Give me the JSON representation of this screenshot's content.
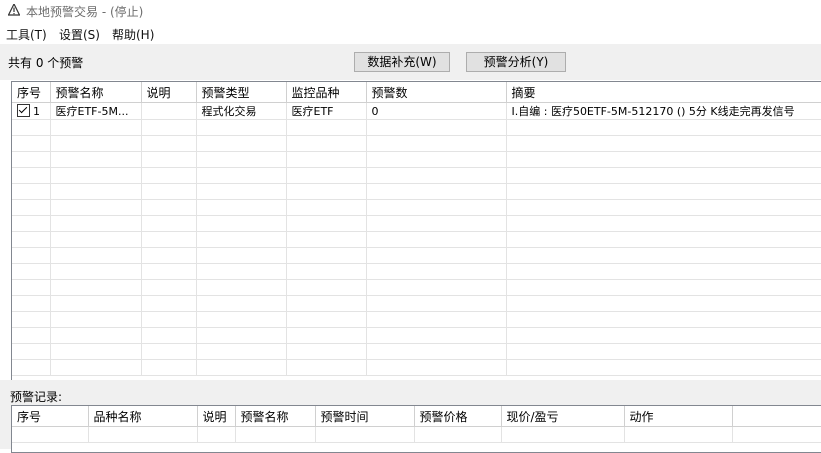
{
  "window": {
    "title": "本地预警交易  - (停止)"
  },
  "menu": {
    "tools": "工具(T)",
    "settings": "设置(S)",
    "help": "帮助(H)"
  },
  "toolbar": {
    "alert_count": "共有 0 个预警",
    "supplement_button": "数据补充(W)",
    "analysis_button": "预警分析(Y)"
  },
  "alerts_table": {
    "headers": [
      "序号",
      "预警名称",
      "说明",
      "预警类型",
      "监控品种",
      "预警数",
      "摘要"
    ],
    "rows": [
      {
        "checked": true,
        "index": "1",
        "name": "医疗ETF-5M...",
        "desc": "",
        "type": "程式化交易",
        "symbol": "医疗ETF",
        "count": "0",
        "summary": "I.自编 : 医疗50ETF-5M-512170 () 5分 K线走完再发信号"
      }
    ]
  },
  "records": {
    "label": "预警记录:",
    "headers": [
      "序号",
      "品种名称",
      "说明",
      "预警名称",
      "预警时间",
      "预警价格",
      "现价/盈亏",
      "动作"
    ]
  }
}
